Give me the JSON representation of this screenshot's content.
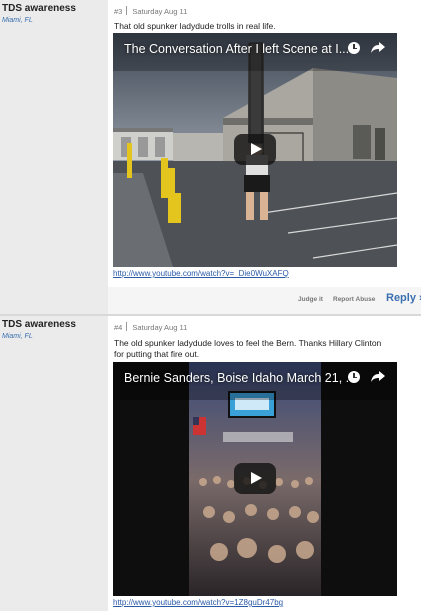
{
  "comments": [
    {
      "author": "TDS awareness",
      "location": "Miami, FL",
      "number": "#3",
      "date": "Saturday Aug 11",
      "body": "That old spunker ladydude trolls in real life.",
      "video": {
        "title": "The Conversation After I left Scene at I...",
        "clock_icon": "clock-icon",
        "share_icon": "share-icon",
        "play_icon": "play-icon"
      },
      "link": "http://www.youtube.com/watch?v=_Die0WuXAFQ",
      "actions": {
        "judge": "Judge it",
        "report": "Report Abuse",
        "reply": "Reply ›"
      }
    },
    {
      "author": "TDS awareness",
      "location": "Miami, FL",
      "number": "#4",
      "date": "Saturday Aug 11",
      "body_line1": "The old spunker ladydude loves to feel the Bern. Thanks Hillary Clinton",
      "body_line2": "for putting that fire out.",
      "video": {
        "title": "Bernie Sanders, Boise Idaho March 21, ...",
        "clock_icon": "clock-icon",
        "share_icon": "share-icon",
        "play_icon": "play-icon"
      },
      "link": "http://www.youtube.com/watch?v=1Z8guDr47bg"
    }
  ],
  "colors": {
    "sidebar": "#ebebeb",
    "link": "#2a5aa8",
    "reply": "#3a6fb0"
  }
}
